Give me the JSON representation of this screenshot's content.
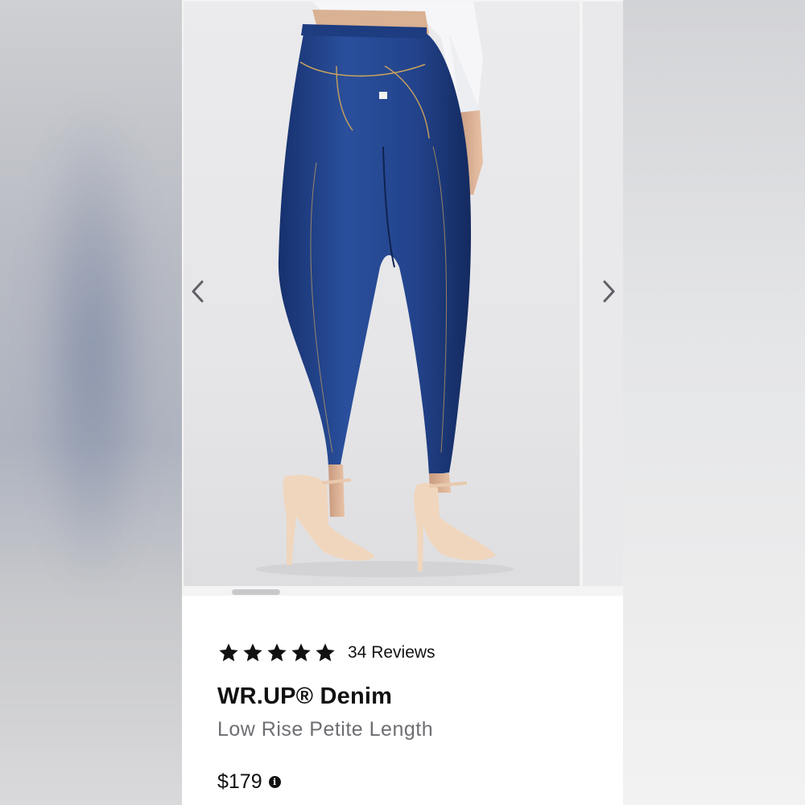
{
  "product": {
    "rating_stars": 5,
    "reviews_label": "34 Reviews",
    "title": "WR.UP® Denim",
    "subtitle": "Low Rise Petite Length",
    "price": "$179"
  },
  "carousel": {
    "prev_icon": "chevron-left-icon",
    "next_icon": "chevron-right-icon"
  },
  "colors": {
    "denim": "#1f3f8a",
    "star": "#111111",
    "subtitle": "#6e6e73"
  }
}
